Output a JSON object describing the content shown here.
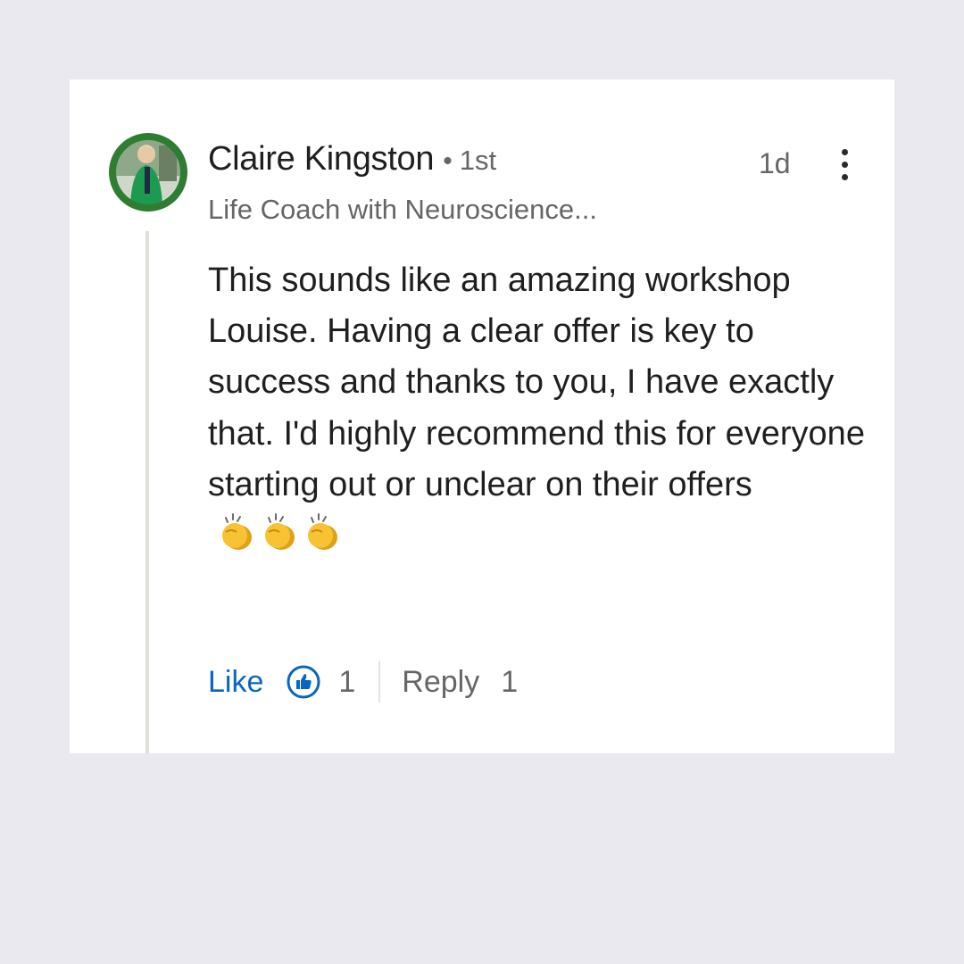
{
  "comment": {
    "author": {
      "name": "Claire Kingston",
      "separator": "•",
      "degree": "1st",
      "headline": "Life Coach with Neuroscience..."
    },
    "timestamp": "1d",
    "body": "This sounds like an amazing workshop Louise. Having a clear offer is key to success and thanks to you, I have exactly that. I'd highly recommend this for everyone starting out or unclear on their offers",
    "emoji_icons": [
      "clapping-hands-icon",
      "clapping-hands-icon",
      "clapping-hands-icon"
    ],
    "actions": {
      "like_label": "Like",
      "like_count": "1",
      "reply_label": "Reply",
      "reply_count": "1"
    }
  },
  "colors": {
    "page_background": "#e9e9ef",
    "card_background": "#ffffff",
    "link_blue": "#0a66c2",
    "secondary_text": "#666666",
    "primary_text": "#1f1f1f",
    "avatar_ring": "#2e7d32"
  }
}
